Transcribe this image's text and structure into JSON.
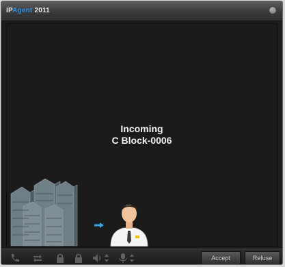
{
  "window": {
    "title_prefix": "IP",
    "title_accent": "Agent",
    "title_suffix": "2011"
  },
  "call": {
    "status": "Incoming",
    "caller": "C Block-0006"
  },
  "toolbar": {
    "accept_label": "Accept",
    "refuse_label": "Refuse"
  },
  "colors": {
    "accent": "#2f8fe0",
    "background": "#1b1b1b",
    "titlebar": "#4a4a4a"
  }
}
